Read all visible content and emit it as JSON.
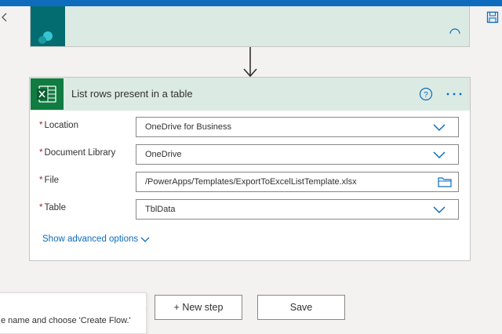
{
  "colors": {
    "accent": "#0f6cbd",
    "excel_green": "#107c41",
    "header_bg": "#dbeae3",
    "required": "#a4262c"
  },
  "previous_step": {
    "icon": "sharepoint-icon"
  },
  "step": {
    "title": "List rows present in a table",
    "icon": "excel-icon",
    "fields": [
      {
        "label": "Location",
        "required_mark": "*",
        "value": "OneDrive for Business",
        "control": "dropdown"
      },
      {
        "label": "Document Library",
        "required_mark": "*",
        "value": "OneDrive",
        "control": "dropdown"
      },
      {
        "label": "File",
        "required_mark": "*",
        "value": "/PowerApps/Templates/ExportToExcelListTemplate.xlsx",
        "control": "file-picker"
      },
      {
        "label": "Table",
        "required_mark": "*",
        "value": "TblData",
        "control": "dropdown"
      }
    ],
    "advanced_label": "Show advanced options"
  },
  "tooltip": {
    "text": "e name and choose 'Create Flow.'"
  },
  "buttons": {
    "new_step": "+ New step",
    "save": "Save"
  }
}
